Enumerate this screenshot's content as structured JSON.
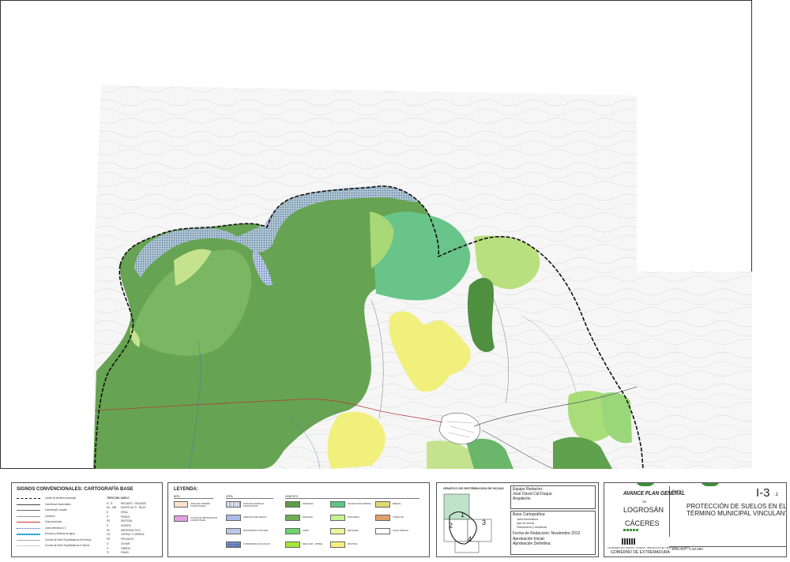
{
  "signos": {
    "title": "SIGNOS CONVENCIONALES: CARTOGRAFÍA BASE",
    "lines": [
      {
        "label": "Límite de término municipal",
        "color": "#111111",
        "style": "dash"
      },
      {
        "label": "Carretera/s Nacionales",
        "color": "#444444",
        "style": "solid"
      },
      {
        "label": "Carretera/s Locales",
        "color": "#666666",
        "style": "thin"
      },
      {
        "label": "Caminos",
        "color": "#999999",
        "style": "thin"
      },
      {
        "label": "Vías pecuarias",
        "color": "#cc3333",
        "style": "solid"
      },
      {
        "label": "Línea eléctrica A.T.",
        "color": "#3355aa",
        "style": "dot"
      },
      {
        "label": "Arroyos y láminas de agua",
        "color": "#33aadd",
        "style": "thick"
      },
      {
        "label": "Curvas de Nivel: Equidistancia 25 metros",
        "color": "#aaaaaa",
        "style": "thin"
      },
      {
        "label": "Curvas de Nivel: Equidistancia 5 metros",
        "color": "#cccccc",
        "style": "thin"
      }
    ],
    "codes_title": "TIPOS DEL SUELO",
    "codes": [
      {
        "code": "R - R",
        "label": "REGADÍO - REGADÍO"
      },
      {
        "code": "ML - MB",
        "label": "MONTE ALTO - BAJO"
      },
      {
        "code": "E",
        "label": "ERIAL"
      },
      {
        "code": "P",
        "label": "PRADO"
      },
      {
        "code": "PS",
        "label": "PASTIZAL"
      },
      {
        "code": "H",
        "label": "HUERTA"
      },
      {
        "code": "IM",
        "label": "IMPRODUCTIVO"
      },
      {
        "code": "CS",
        "label": "CEREAL Y DEHESA"
      },
      {
        "code": "FR",
        "label": "FRUTALES"
      },
      {
        "code": "O",
        "label": "OLIVAR"
      },
      {
        "code": "V",
        "label": "VIÑEDO"
      },
      {
        "code": "PI",
        "label": "PINAR"
      }
    ]
  },
  "leyenda": {
    "title": "LEYENDA:",
    "col1_head": "BIPA",
    "col2_head": "ZEPA",
    "col3_head": "HÁBITATS",
    "items_col1": [
      {
        "label": "ZONA DE INTERÉS COMUNITARIO",
        "color": "#fbe3cf",
        "pattern": "none"
      },
      {
        "label": "LUGAR DE IMPORTANCIA COMUNITARIA",
        "color": "#f3c7ee",
        "pattern": "hatch-pink"
      }
    ],
    "items_col2": [
      {
        "label": "ZONA DE ESPECIAL PROTECCIÓN",
        "color": "#ffffff",
        "pattern": "vlines"
      },
      {
        "label": "ÁREA DE INFLUENCIA",
        "color": "#a9bde8",
        "pattern": "none"
      },
      {
        "label": "MONUMENTO NATURAL",
        "color": "#dde6f7",
        "pattern": "dots"
      },
      {
        "label": "CORREDOR ECOLÓGICO",
        "color": "#cfd9f0",
        "pattern": "dots-dense"
      }
    ],
    "items_col3a": [
      {
        "label": "DEHESAS",
        "color": "#5e9b46"
      },
      {
        "label": "ENCINAR",
        "color": "#6fae52"
      },
      {
        "label": "CORK",
        "color": "#73d36b"
      },
      {
        "label": "MELOJAR - ROBLE",
        "color": "#a6e63a"
      }
    ],
    "items_col3b": [
      {
        "label": "VEGETACIÓN RIPARIA",
        "color": "#5cc584"
      },
      {
        "label": "MATORRAL",
        "color": "#c7f28e"
      },
      {
        "label": "RETAMAR",
        "color": "#e9f59a"
      },
      {
        "label": "PASTIZAL",
        "color": "#f5f07a"
      }
    ],
    "items_col3c": [
      {
        "label": "BREZAL",
        "color": "#ddd96f"
      },
      {
        "label": "TOMILLAR",
        "color": "#e0a06a"
      },
      {
        "label": "ZONA URBANA",
        "color": "#ffffff"
      }
    ]
  },
  "grafico": {
    "title": "GRAFICO DE DISTRIBUCION DE HOJAS",
    "sheets": [
      "1",
      "2",
      "3",
      "4"
    ]
  },
  "equipo": {
    "title": "Equipo Redactor:",
    "name": "José David Cid Duque",
    "role": "Arquitecto",
    "base_title": "Base Cartográfica:",
    "base_lines": [
      "Junta Extremadura",
      "Ayto de Llerena",
      "Planeamiento y Urbanismo"
    ],
    "fecha": "Fecha de Redacción: Noviembre 2012",
    "aprob1": "Aprobación Inicial:",
    "aprob2": "Aprobación Definitiva:"
  },
  "title_block": {
    "plan_title": "AVANCE PLAN GENERAL",
    "de": "DE",
    "town": "LOGROSÁN",
    "province": "CÁCERES",
    "plano_label": "PLANO:",
    "plano_number": "I-3",
    "plano_sub": ".1",
    "plano_title_1": "PROTECCIÓN DE SUELOS EN EL",
    "plano_title_2": "TÉRMINO MUNICIPAL VINCULANTE",
    "escala": "ESCALA : 1:20.000",
    "org_small": "CONSEJERÍA DE FOMENTO, VIVIENDA, ORDENACIÓN DEL TERRITORIO Y TURISMO",
    "gobierno": "GOBIERNO DE EXTREMADURA"
  },
  "map": {
    "colors": {
      "encinar": "#5fa14c",
      "dehesa": "#6aa85a",
      "riparia": "#5bbd7f",
      "matorral": "#b7df78",
      "pastizal": "#eef07a",
      "zepa": "#8fa9d8",
      "boundary": "#111111"
    }
  }
}
